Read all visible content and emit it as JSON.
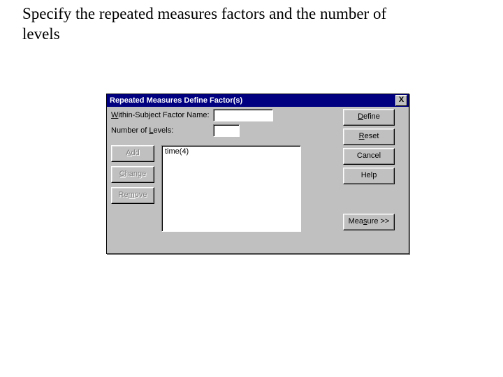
{
  "page": {
    "heading": "Specify the repeated measures factors and the number of levels"
  },
  "dialog": {
    "title": "Repeated Measures Define Factor(s)",
    "close_glyph": "X",
    "labels": {
      "within_pre": "W",
      "within_rest": "ithin-Subject Factor Name:",
      "levels_pre": "Number of ",
      "levels_u": "L",
      "levels_post": "evels:"
    },
    "inputs": {
      "factor_name": "",
      "num_levels": ""
    },
    "list_items": [
      "time(4)"
    ],
    "buttons": {
      "add_u": "A",
      "add_rest": "dd",
      "change_u": "C",
      "change_rest": "hange",
      "remove_pre": "Re",
      "remove_u": "m",
      "remove_post": "ove",
      "define_u": "D",
      "define_rest": "efine",
      "reset_u": "R",
      "reset_rest": "eset",
      "cancel": "Cancel",
      "help": "Help",
      "measure_pre": "Mea",
      "measure_u": "s",
      "measure_post": "ure >>"
    }
  }
}
